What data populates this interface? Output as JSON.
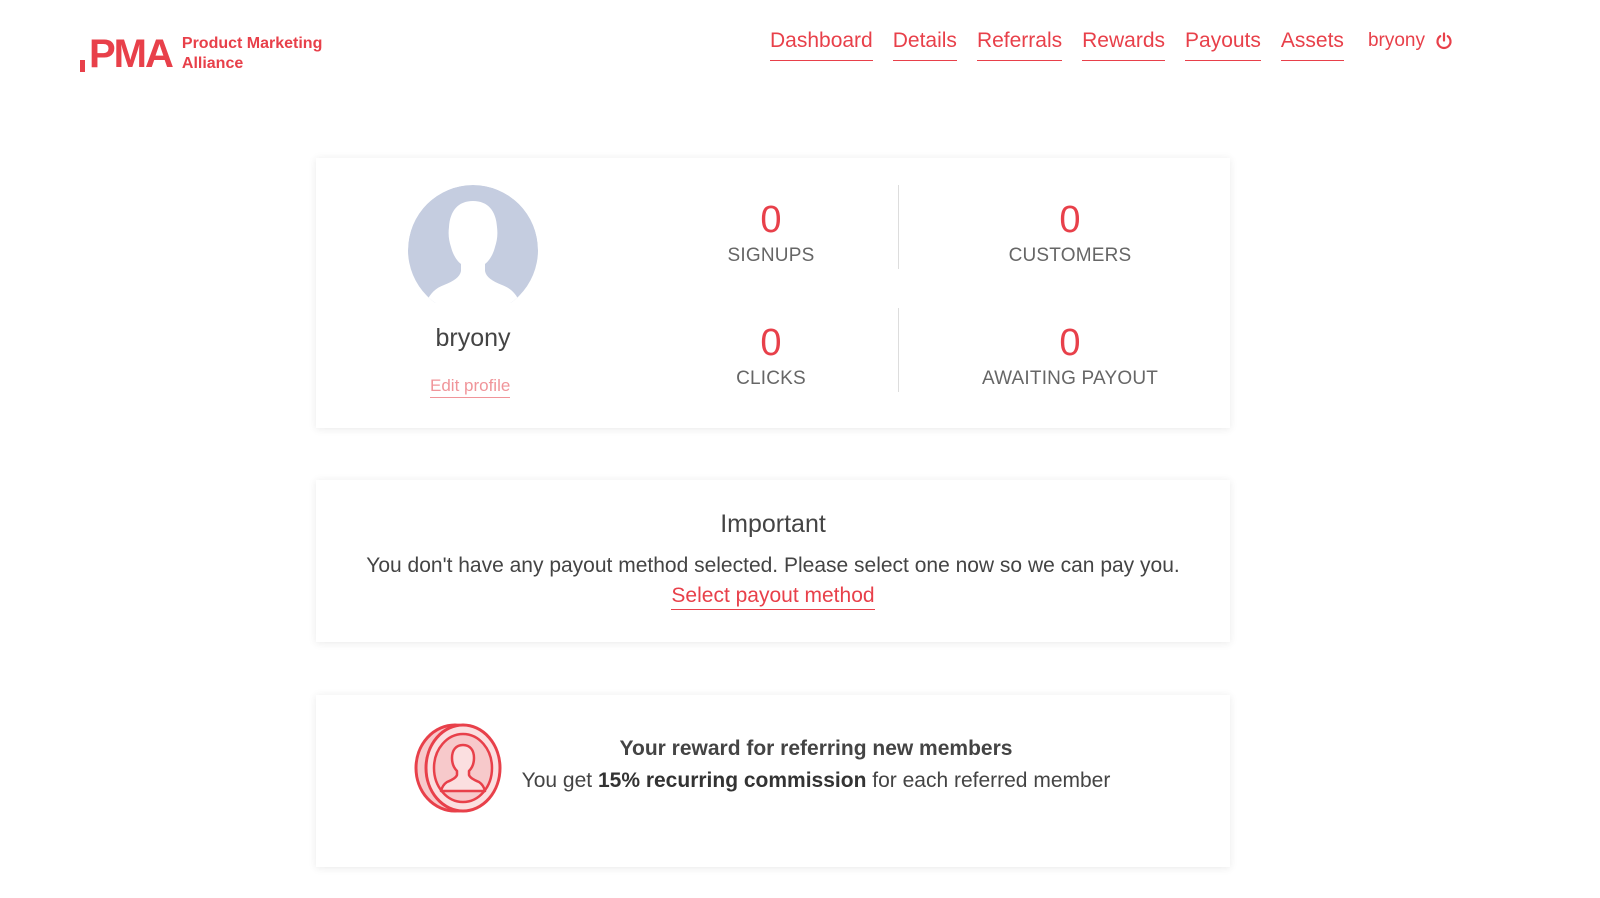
{
  "brand": {
    "mark": "PMA",
    "name_line1": "Product Marketing",
    "name_line2": "Alliance",
    "accent_color": "#e8404a"
  },
  "nav": {
    "items": [
      {
        "label": "Dashboard"
      },
      {
        "label": "Details"
      },
      {
        "label": "Referrals"
      },
      {
        "label": "Rewards"
      },
      {
        "label": "Payouts"
      },
      {
        "label": "Assets"
      }
    ],
    "username": "bryony",
    "logout_icon": "power-icon"
  },
  "profile": {
    "name": "bryony",
    "edit_label": "Edit profile",
    "avatar_icon": "user-silhouette-icon"
  },
  "stats": {
    "signups": {
      "value": "0",
      "label": "SIGNUPS"
    },
    "customers": {
      "value": "0",
      "label": "CUSTOMERS"
    },
    "clicks": {
      "value": "0",
      "label": "CLICKS"
    },
    "awaiting_payout": {
      "value": "0",
      "label": "AWAITING PAYOUT"
    }
  },
  "important": {
    "title": "Important",
    "message": "You don't have any payout method selected. Please select one now so we can pay you.",
    "link_label": "Select payout method"
  },
  "reward": {
    "icon": "coin-user-icon",
    "title": "Your reward for referring new members",
    "text_prefix": "You get ",
    "text_bold": "15% recurring commission",
    "text_suffix": " for each referred member"
  }
}
